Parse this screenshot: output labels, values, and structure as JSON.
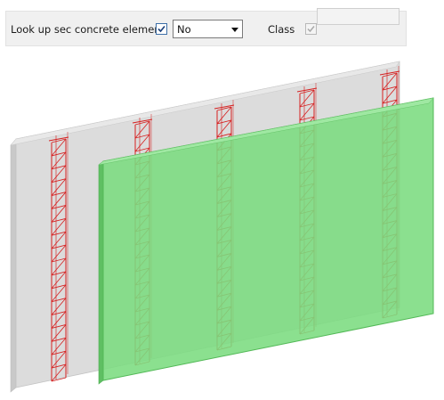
{
  "toolbar": {
    "lookup_label": "Look up sec concrete element",
    "lookup_checked": true,
    "select_value": "No",
    "class_label": "Class",
    "class_checked": true,
    "class_enabled": false,
    "class_value": ""
  },
  "icons": {
    "checkmark": "checkmark-icon",
    "dropdown": "chevron-down-icon"
  },
  "scene": {
    "back_panel_color": "#dcdcdc",
    "front_panel_color": "#7bdc7f",
    "reinforcement_color": "#d62020",
    "reinforcement_cages": 5
  }
}
